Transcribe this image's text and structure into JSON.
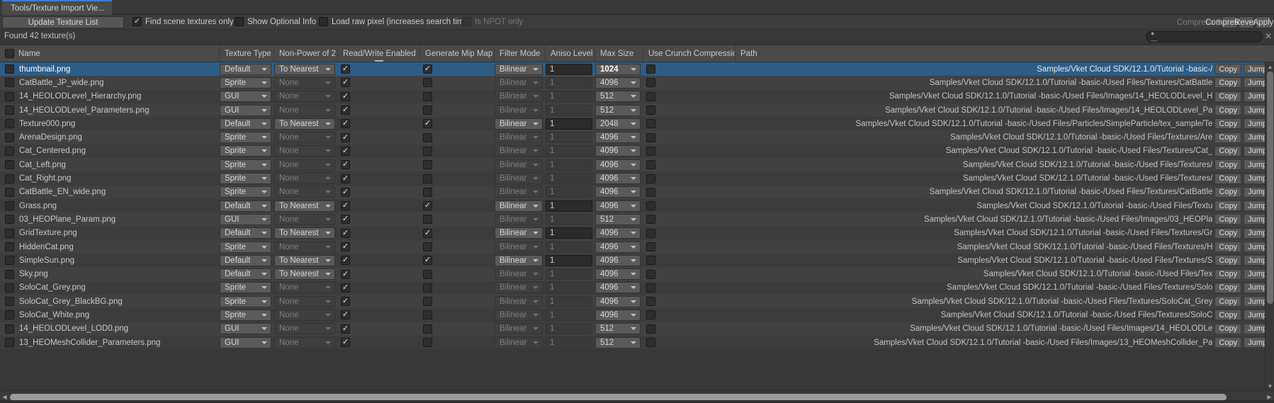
{
  "window": {
    "tab_title": "Tools/Texture Import Vie...",
    "accent": "#3b7fd4"
  },
  "toolbar": {
    "update_button": "Update Texture List",
    "find_scene_textures_label": "Find scene textures only",
    "find_scene_textures_checked": true,
    "show_optional_info_label": "Show Optional Info",
    "show_optional_info_checked": false,
    "load_raw_pixel_label": "Load raw pixel (increases search time)",
    "load_raw_pixel_checked": false,
    "is_npot_only_label": "Is NPOT only",
    "is_npot_only_checked": false,
    "compress_selected": "Compress Selected",
    "compress_all": "Compress All",
    "revert": "Revert",
    "apply": "Apply"
  },
  "status": {
    "found_label": "Found 42 texture(s)",
    "search_value": "",
    "search_placeholder": "",
    "search_icon": "search-icon",
    "clear_icon": "close-icon"
  },
  "table": {
    "columns": [
      "Name",
      "Texture Type",
      "Non-Power of 2",
      "Read/Write Enabled",
      "Generate Mip Map",
      "Filter Mode",
      "Aniso Level",
      "Max Size",
      "Use Crunch Compression",
      "Path"
    ],
    "sorted_column": "Read/Write Enabled",
    "sort_direction": "descending",
    "row_actions": {
      "copy": "Copy",
      "jump": "Jump"
    },
    "rows": [
      {
        "selected": true,
        "name": "thumbnail.png",
        "texture_type": "Default",
        "npot": "To Nearest",
        "npot_dim": false,
        "readwrite": true,
        "mipmap": true,
        "filter_mode": "Bilinear",
        "filter_dim": false,
        "aniso": "1",
        "aniso_dim": false,
        "max_size": "1024",
        "max_size_bold": true,
        "crunch": false,
        "path": "Samples/Vket Cloud SDK/12.1.0/Tutorial -basic-/"
      },
      {
        "selected": false,
        "name": "CatBattle_JP_wide.png",
        "texture_type": "Sprite",
        "npot": "None",
        "npot_dim": true,
        "readwrite": true,
        "mipmap": false,
        "filter_mode": "Bilinear",
        "filter_dim": true,
        "aniso": "1",
        "aniso_dim": true,
        "max_size": "4096",
        "max_size_bold": false,
        "crunch": false,
        "path": "Samples/Vket Cloud SDK/12.1.0/Tutorial -basic-/Used Files/Textures/CatBattle"
      },
      {
        "selected": false,
        "name": "14_HEOLODLevel_Hierarchy.png",
        "texture_type": "GUI",
        "npot": "None",
        "npot_dim": true,
        "readwrite": true,
        "mipmap": false,
        "filter_mode": "Bilinear",
        "filter_dim": true,
        "aniso": "1",
        "aniso_dim": true,
        "max_size": "512",
        "max_size_bold": false,
        "crunch": false,
        "path": "Samples/Vket Cloud SDK/12.1.0/Tutorial -basic-/Used Files/Images/14_HEOLODLevel_H"
      },
      {
        "selected": false,
        "name": "14_HEOLODLevel_Parameters.png",
        "texture_type": "GUI",
        "npot": "None",
        "npot_dim": true,
        "readwrite": true,
        "mipmap": false,
        "filter_mode": "Bilinear",
        "filter_dim": true,
        "aniso": "1",
        "aniso_dim": true,
        "max_size": "512",
        "max_size_bold": false,
        "crunch": false,
        "path": "Samples/Vket Cloud SDK/12.1.0/Tutorial -basic-/Used Files/Images/14_HEOLODLevel_Pa"
      },
      {
        "selected": false,
        "name": "Texture000.png",
        "texture_type": "Default",
        "npot": "To Nearest",
        "npot_dim": false,
        "readwrite": true,
        "mipmap": true,
        "filter_mode": "Bilinear",
        "filter_dim": false,
        "aniso": "1",
        "aniso_dim": false,
        "max_size": "2048",
        "max_size_bold": false,
        "crunch": false,
        "path": "Samples/Vket Cloud SDK/12.1.0/Tutorial -basic-/Used Files/Particles/SimpleParticle/tex_sample/Te"
      },
      {
        "selected": false,
        "name": "ArenaDesign.png",
        "texture_type": "Sprite",
        "npot": "None",
        "npot_dim": true,
        "readwrite": true,
        "mipmap": false,
        "filter_mode": "Bilinear",
        "filter_dim": true,
        "aniso": "1",
        "aniso_dim": true,
        "max_size": "4096",
        "max_size_bold": false,
        "crunch": false,
        "path": "Samples/Vket Cloud SDK/12.1.0/Tutorial -basic-/Used Files/Textures/Are"
      },
      {
        "selected": false,
        "name": "Cat_Centered.png",
        "texture_type": "Sprite",
        "npot": "None",
        "npot_dim": true,
        "readwrite": true,
        "mipmap": false,
        "filter_mode": "Bilinear",
        "filter_dim": true,
        "aniso": "1",
        "aniso_dim": true,
        "max_size": "4096",
        "max_size_bold": false,
        "crunch": false,
        "path": "Samples/Vket Cloud SDK/12.1.0/Tutorial -basic-/Used Files/Textures/Cat_"
      },
      {
        "selected": false,
        "name": "Cat_Left.png",
        "texture_type": "Sprite",
        "npot": "None",
        "npot_dim": true,
        "readwrite": true,
        "mipmap": false,
        "filter_mode": "Bilinear",
        "filter_dim": true,
        "aniso": "1",
        "aniso_dim": true,
        "max_size": "4096",
        "max_size_bold": false,
        "crunch": false,
        "path": "Samples/Vket Cloud SDK/12.1.0/Tutorial -basic-/Used Files/Textures/"
      },
      {
        "selected": false,
        "name": "Cat_Right.png",
        "texture_type": "Sprite",
        "npot": "None",
        "npot_dim": true,
        "readwrite": true,
        "mipmap": false,
        "filter_mode": "Bilinear",
        "filter_dim": true,
        "aniso": "1",
        "aniso_dim": true,
        "max_size": "4096",
        "max_size_bold": false,
        "crunch": false,
        "path": "Samples/Vket Cloud SDK/12.1.0/Tutorial -basic-/Used Files/Textures/"
      },
      {
        "selected": false,
        "name": "CatBattle_EN_wide.png",
        "texture_type": "Sprite",
        "npot": "None",
        "npot_dim": true,
        "readwrite": true,
        "mipmap": false,
        "filter_mode": "Bilinear",
        "filter_dim": true,
        "aniso": "1",
        "aniso_dim": true,
        "max_size": "4096",
        "max_size_bold": false,
        "crunch": false,
        "path": "Samples/Vket Cloud SDK/12.1.0/Tutorial -basic-/Used Files/Textures/CatBattle"
      },
      {
        "selected": false,
        "name": "Grass.png",
        "texture_type": "Default",
        "npot": "To Nearest",
        "npot_dim": false,
        "readwrite": true,
        "mipmap": true,
        "filter_mode": "Bilinear",
        "filter_dim": false,
        "aniso": "1",
        "aniso_dim": false,
        "max_size": "4096",
        "max_size_bold": false,
        "crunch": false,
        "path": "Samples/Vket Cloud SDK/12.1.0/Tutorial -basic-/Used Files/Textu"
      },
      {
        "selected": false,
        "name": "03_HEOPlane_Param.png",
        "texture_type": "GUI",
        "npot": "None",
        "npot_dim": true,
        "readwrite": true,
        "mipmap": false,
        "filter_mode": "Bilinear",
        "filter_dim": true,
        "aniso": "1",
        "aniso_dim": true,
        "max_size": "512",
        "max_size_bold": false,
        "crunch": false,
        "path": "Samples/Vket Cloud SDK/12.1.0/Tutorial -basic-/Used Files/Images/03_HEOPla"
      },
      {
        "selected": false,
        "name": "GridTexture.png",
        "texture_type": "Default",
        "npot": "To Nearest",
        "npot_dim": false,
        "readwrite": true,
        "mipmap": true,
        "filter_mode": "Bilinear",
        "filter_dim": false,
        "aniso": "1",
        "aniso_dim": false,
        "max_size": "4096",
        "max_size_bold": false,
        "crunch": false,
        "path": "Samples/Vket Cloud SDK/12.1.0/Tutorial -basic-/Used Files/Textures/Gr"
      },
      {
        "selected": false,
        "name": "HiddenCat.png",
        "texture_type": "Sprite",
        "npot": "None",
        "npot_dim": true,
        "readwrite": true,
        "mipmap": false,
        "filter_mode": "Bilinear",
        "filter_dim": true,
        "aniso": "1",
        "aniso_dim": true,
        "max_size": "4096",
        "max_size_bold": false,
        "crunch": false,
        "path": "Samples/Vket Cloud SDK/12.1.0/Tutorial -basic-/Used Files/Textures/H"
      },
      {
        "selected": false,
        "name": "SimpleSun.png",
        "texture_type": "Default",
        "npot": "To Nearest",
        "npot_dim": false,
        "readwrite": true,
        "mipmap": true,
        "filter_mode": "Bilinear",
        "filter_dim": false,
        "aniso": "1",
        "aniso_dim": false,
        "max_size": "4096",
        "max_size_bold": false,
        "crunch": false,
        "path": "Samples/Vket Cloud SDK/12.1.0/Tutorial -basic-/Used Files/Textures/S"
      },
      {
        "selected": false,
        "name": "Sky.png",
        "texture_type": "Default",
        "npot": "To Nearest",
        "npot_dim": false,
        "readwrite": true,
        "mipmap": false,
        "filter_mode": "Bilinear",
        "filter_dim": true,
        "aniso": "1",
        "aniso_dim": true,
        "max_size": "4096",
        "max_size_bold": false,
        "crunch": false,
        "path": "Samples/Vket Cloud SDK/12.1.0/Tutorial -basic-/Used Files/Tex"
      },
      {
        "selected": false,
        "name": "SoloCat_Grey.png",
        "texture_type": "Sprite",
        "npot": "None",
        "npot_dim": true,
        "readwrite": true,
        "mipmap": false,
        "filter_mode": "Bilinear",
        "filter_dim": true,
        "aniso": "1",
        "aniso_dim": true,
        "max_size": "4096",
        "max_size_bold": false,
        "crunch": false,
        "path": "Samples/Vket Cloud SDK/12.1.0/Tutorial -basic-/Used Files/Textures/Solo"
      },
      {
        "selected": false,
        "name": "SoloCat_Grey_BlackBG.png",
        "texture_type": "Sprite",
        "npot": "None",
        "npot_dim": true,
        "readwrite": true,
        "mipmap": false,
        "filter_mode": "Bilinear",
        "filter_dim": true,
        "aniso": "1",
        "aniso_dim": true,
        "max_size": "4096",
        "max_size_bold": false,
        "crunch": false,
        "path": "Samples/Vket Cloud SDK/12.1.0/Tutorial -basic-/Used Files/Textures/SoloCat_Grey"
      },
      {
        "selected": false,
        "name": "SoloCat_White.png",
        "texture_type": "Sprite",
        "npot": "None",
        "npot_dim": true,
        "readwrite": true,
        "mipmap": false,
        "filter_mode": "Bilinear",
        "filter_dim": true,
        "aniso": "1",
        "aniso_dim": true,
        "max_size": "4096",
        "max_size_bold": false,
        "crunch": false,
        "path": "Samples/Vket Cloud SDK/12.1.0/Tutorial -basic-/Used Files/Textures/SoloC"
      },
      {
        "selected": false,
        "name": "14_HEOLODLevel_LOD0.png",
        "texture_type": "GUI",
        "npot": "None",
        "npot_dim": true,
        "readwrite": true,
        "mipmap": false,
        "filter_mode": "Bilinear",
        "filter_dim": true,
        "aniso": "1",
        "aniso_dim": true,
        "max_size": "512",
        "max_size_bold": false,
        "crunch": false,
        "path": "Samples/Vket Cloud SDK/12.1.0/Tutorial -basic-/Used Files/Images/14_HEOLODLe"
      },
      {
        "selected": false,
        "name": "13_HEOMeshCollider_Parameters.png",
        "texture_type": "GUI",
        "npot": "None",
        "npot_dim": true,
        "readwrite": true,
        "mipmap": false,
        "filter_mode": "Bilinear",
        "filter_dim": true,
        "aniso": "1",
        "aniso_dim": true,
        "max_size": "512",
        "max_size_bold": false,
        "crunch": false,
        "path": "Samples/Vket Cloud SDK/12.1.0/Tutorial -basic-/Used Files/Images/13_HEOMeshCollider_Pa"
      }
    ]
  },
  "scrollbars": {
    "vertical_thumb_pct": 75,
    "horizontal_thumb_pct": 97,
    "up_arrow_icon": "caret-up-icon",
    "down_arrow_icon": "caret-down-icon",
    "left_arrow_icon": "caret-left-icon",
    "right_arrow_icon": "caret-right-icon"
  }
}
